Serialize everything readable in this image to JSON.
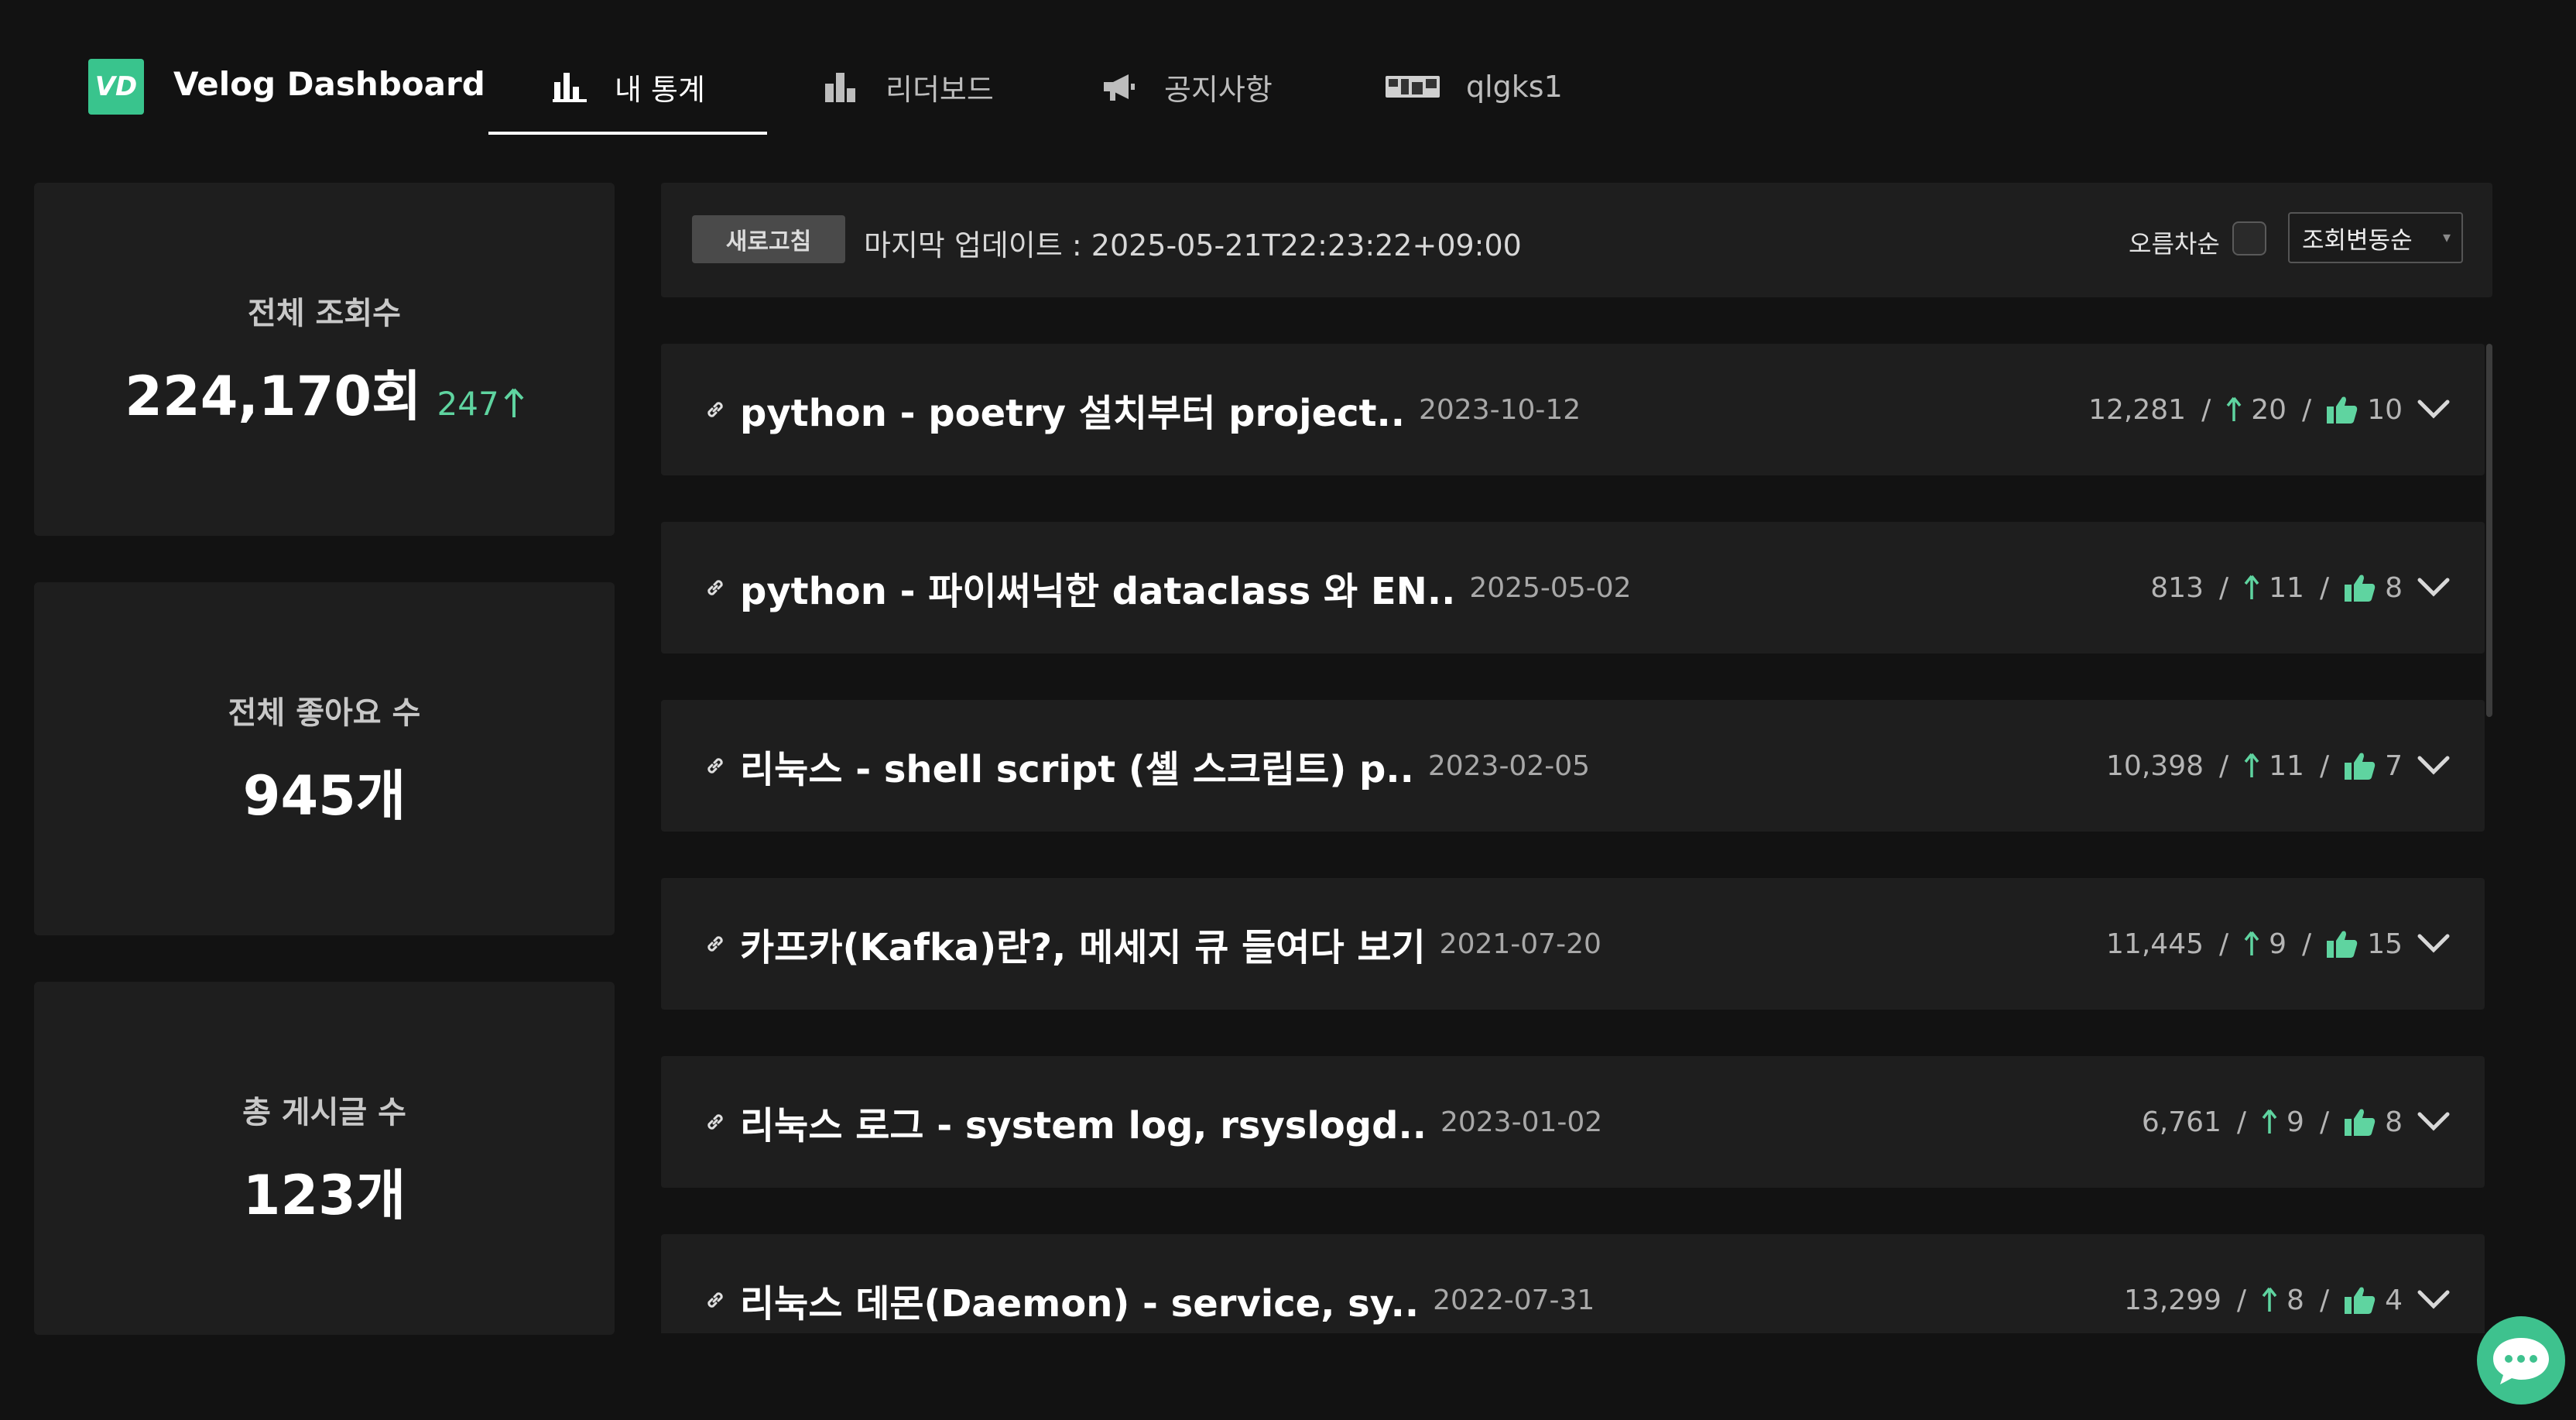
{
  "header": {
    "logo_text": "VD",
    "brand": "Velog Dashboard",
    "nav": [
      {
        "label": "내 통계",
        "icon": "bar-chart-icon",
        "active": true
      },
      {
        "label": "리더보드",
        "icon": "leaderboard-icon",
        "active": false
      },
      {
        "label": "공지사항",
        "icon": "megaphone-icon",
        "active": false
      },
      {
        "label": "qlgks1",
        "icon": "profile-banner-icon",
        "active": false
      }
    ]
  },
  "stats": [
    {
      "label": "전체 조회수",
      "value": "224,170회",
      "delta": "247"
    },
    {
      "label": "전체 좋아요 수",
      "value": "945개"
    },
    {
      "label": "총 게시글 수",
      "value": "123개"
    }
  ],
  "toolbar": {
    "refresh_label": "새로고침",
    "last_update": "마지막 업데이트 : 2025-05-21T22:23:22+09:00",
    "ascending_label": "오름차순",
    "ascending_checked": false,
    "sort_selected": "조회변동순"
  },
  "posts": [
    {
      "title": "python - poetry 설치부터 project..",
      "date": "2023-10-12",
      "views": "12,281",
      "view_delta": "20",
      "likes": "10"
    },
    {
      "title": "python - 파이써닉한 dataclass 와 EN..",
      "date": "2025-05-02",
      "views": "813",
      "view_delta": "11",
      "likes": "8"
    },
    {
      "title": "리눅스 - shell script (셸 스크립트) p..",
      "date": "2023-02-05",
      "views": "10,398",
      "view_delta": "11",
      "likes": "7"
    },
    {
      "title": "카프카(Kafka)란?, 메세지 큐 들여다 보기",
      "date": "2021-07-20",
      "views": "11,445",
      "view_delta": "9",
      "likes": "15"
    },
    {
      "title": "리눅스 로그 - system log, rsyslogd..",
      "date": "2023-01-02",
      "views": "6,761",
      "view_delta": "9",
      "likes": "8"
    },
    {
      "title": "리눅스 데몬(Daemon) - service, sy..",
      "date": "2022-07-31",
      "views": "13,299",
      "view_delta": "8",
      "likes": "4"
    }
  ],
  "colors": {
    "accent": "#39c48d",
    "background": "#121212",
    "card": "#1e1e1e",
    "delta": "#5fd4a0"
  }
}
